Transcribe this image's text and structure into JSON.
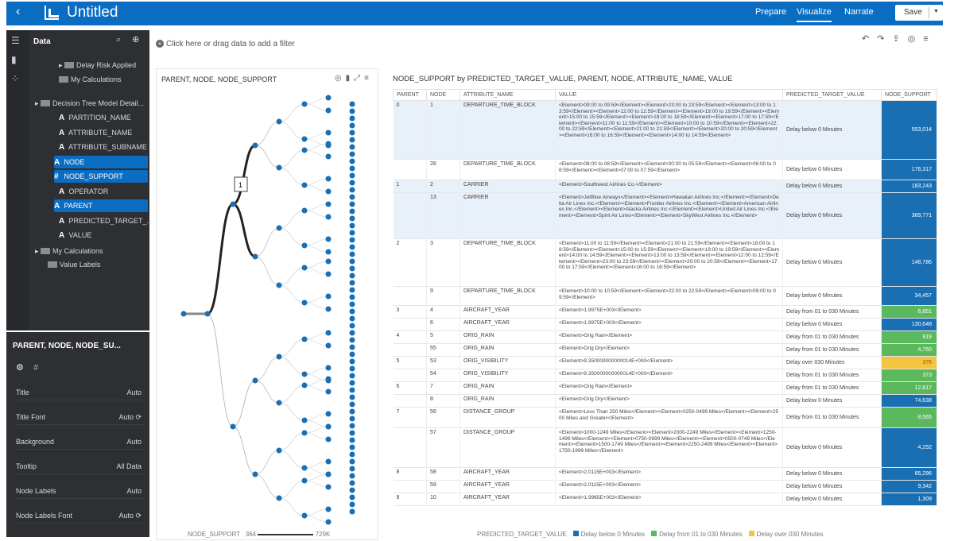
{
  "topbar": {
    "back": "‹",
    "title": "Untitled",
    "nav": [
      "Prepare",
      "Visualize",
      "Narrate"
    ],
    "active_nav": "Visualize",
    "save": "Save",
    "caret": "▼"
  },
  "data_panel": {
    "title": "Data",
    "items": [
      {
        "label": "Delay Risk Applied"
      },
      {
        "label": "My Calculations"
      },
      {
        "label": "Decision Tree Model Detail..."
      },
      {
        "label": "PARTITION_NAME",
        "glyph": "A"
      },
      {
        "label": "ATTRIBUTE_NAME",
        "glyph": "A"
      },
      {
        "label": "ATTRIBUTE_SUBNAME",
        "glyph": "A"
      },
      {
        "label": "NODE",
        "glyph": "A",
        "selected": true
      },
      {
        "label": "NODE_SUPPORT",
        "glyph": "#",
        "selected": true
      },
      {
        "label": "OPERATOR",
        "glyph": "A"
      },
      {
        "label": "PARENT",
        "glyph": "A",
        "selected": true
      },
      {
        "label": "PREDICTED_TARGET_...",
        "glyph": "A"
      },
      {
        "label": "VALUE",
        "glyph": "A"
      },
      {
        "label": "My Calculations"
      },
      {
        "label": "Value Labels"
      }
    ]
  },
  "props_panel": {
    "header": "PARENT, NODE, NODE_SU...",
    "tab2": "#",
    "rows": [
      {
        "label": "Title",
        "value": "Auto"
      },
      {
        "label": "Title Font",
        "value": "Auto ⟳"
      },
      {
        "label": "Background",
        "value": "Auto"
      },
      {
        "label": "Tooltip",
        "value": "All Data"
      },
      {
        "label": "Node Labels",
        "value": "Auto"
      },
      {
        "label": "Node Labels Font",
        "value": "Auto ⟳"
      }
    ]
  },
  "filter_bar": {
    "placeholder": "Click here or drag data to add a filter"
  },
  "tree_panel": {
    "title": "PARENT, NODE, NODE_SUPPORT",
    "tooltip_value": "1",
    "legend": {
      "label": "NODE_SUPPORT",
      "min": "364",
      "max": "729K"
    }
  },
  "table_panel": {
    "title": "NODE_SUPPORT by PREDICTED_TARGET_VALUE, PARENT, NODE, ATTRIBUTE_NAME, VALUE",
    "columns": [
      "PARENT",
      "NODE",
      "ATTRIBUTE_NAME",
      "VALUE",
      "PREDICTED_TARGET_VALUE",
      "NODE_SUPPORT"
    ],
    "rows": [
      {
        "parent": "0",
        "node": "1",
        "attr": "DEPARTURE_TIME_BLOCK",
        "value": "<Element>09:00 to 09:59</Element><Element>23:00 to 23:59</Element><Element>13:00 to 13:59</Element><Element>12:00 to 12:59</Element><Element>19:00 to 19:59</Element><Element>15:00 to 15:59</Element><Element>18:00 to 18:59</Element><Element>17:00 to 17:59</Element><Element>11:00 to 11:59</Element><Element>10:00 to 10:59</Element><Element>22:00 to 22:59</Element><Element>21:00 to 21:59</Element><Element>20:00 to 20:59</Element><Element>16:00 to 16:59</Element><Element>14:00 to 14:59</Element>",
        "pred": "Delay below 0 Minutes",
        "support": "553,014",
        "cls": "blue",
        "hl": true,
        "h": 74
      },
      {
        "parent": "",
        "node": "28",
        "attr": "DEPARTURE_TIME_BLOCK",
        "value": "<Element>08:00 to 08:59</Element><Element>00:00 to 05:59</Element><Element>06:00 to 06:59</Element><Element>07:00 to 07:59</Element>",
        "pred": "Delay below 0 Minutes",
        "support": "176,317",
        "cls": "blue",
        "hl": false,
        "h": 26
      },
      {
        "parent": "1",
        "node": "2",
        "attr": "CARRIER",
        "value": "<Element>Southwest Airlines Co.</Element>",
        "pred": "Delay below 0 Minutes",
        "support": "183,243",
        "cls": "blue",
        "hl": true,
        "h": 16
      },
      {
        "parent": "",
        "node": "13",
        "attr": "CARRIER",
        "value": "<Element>JetBlue Airways</Element><Element>Hawaiian Airlines Inc.</Element><Element>Delta Air Lines Inc.</Element><Element>Frontier Airlines Inc.</Element><Element>American Airlines Inc.</Element><Element>Alaska Airlines Inc.</Element><Element>United Air Lines Inc.</Element><Element>Spirit Air Lines</Element><Element>SkyWest Airlines Inc.</Element>",
        "pred": "Delay below 0 Minutes",
        "support": "369,771",
        "cls": "blue",
        "hl": true,
        "h": 58
      },
      {
        "parent": "2",
        "node": "3",
        "attr": "DEPARTURE_TIME_BLOCK",
        "value": "<Element>11:00 to 11:59</Element><Element>21:00 to 21:59</Element><Element>18:00 to 18:59</Element><Element>15:00 to 15:59</Element><Element>19:00 to 19:59</Element><Element>14:00 to 14:59</Element><Element>13:00 to 13:59</Element><Element>12:00 to 12:59</Element><Element>23:00 to 23:59</Element><Element>20:00 to 20:59</Element><Element>17:00 to 17:59</Element><Element>16:00 to 16:59</Element>",
        "pred": "Delay below 0 Minutes",
        "support": "148,786",
        "cls": "blue",
        "hl": false,
        "h": 60
      },
      {
        "parent": "",
        "node": "9",
        "attr": "DEPARTURE_TIME_BLOCK",
        "value": "<Element>10:00 to 10:59</Element><Element>22:00 to 22:59</Element><Element>09:00 to 09:59</Element>",
        "pred": "Delay below 0 Minutes",
        "support": "34,457",
        "cls": "blue",
        "hl": false,
        "h": 24
      },
      {
        "parent": "3",
        "node": "4",
        "attr": "AIRCRAFT_YEAR",
        "value": "<Element>1.9975E+003</Element>",
        "pred": "Delay from 01 to 030 Minutes",
        "support": "6,851",
        "cls": "green",
        "hl": false,
        "h": 16
      },
      {
        "parent": "",
        "node": "6",
        "attr": "AIRCRAFT_YEAR",
        "value": "<Element>1.9975E+003</Element>",
        "pred": "Delay below 0 Minutes",
        "support": "130,648",
        "cls": "blue",
        "hl": false,
        "h": 16
      },
      {
        "parent": "4",
        "node": "5",
        "attr": "ORIG_RAIN",
        "value": "<Element>Orig Rain</Element>",
        "pred": "Delay from 01 to 030 Minutes",
        "support": "819",
        "cls": "green",
        "hl": false,
        "h": 16
      },
      {
        "parent": "",
        "node": "55",
        "attr": "ORIG_RAIN",
        "value": "<Element>Orig Dry</Element>",
        "pred": "Delay from 01 to 030 Minutes",
        "support": "4,750",
        "cls": "green",
        "hl": false,
        "h": 16
      },
      {
        "parent": "5",
        "node": "53",
        "attr": "ORIG_VISIBILITY",
        "value": "<Element>9.350000000000014E+000</Element>",
        "pred": "Delay over 030 Minutes",
        "support": "376",
        "cls": "yellow",
        "hl": false,
        "h": 16
      },
      {
        "parent": "",
        "node": "54",
        "attr": "ORIG_VISIBILITY",
        "value": "<Element>9.350000000000014E+000</Element>",
        "pred": "Delay from 01 to 030 Minutes",
        "support": "373",
        "cls": "green",
        "hl": false,
        "h": 16
      },
      {
        "parent": "6",
        "node": "7",
        "attr": "ORIG_RAIN",
        "value": "<Element>Orig Rain</Element>",
        "pred": "Delay from 01 to 030 Minutes",
        "support": "12,817",
        "cls": "green",
        "hl": false,
        "h": 16
      },
      {
        "parent": "",
        "node": "8",
        "attr": "ORIG_RAIN",
        "value": "<Element>Orig Dry</Element>",
        "pred": "Delay below 0 Minutes",
        "support": "74,638",
        "cls": "blue",
        "hl": false,
        "h": 16
      },
      {
        "parent": "7",
        "node": "56",
        "attr": "DISTANCE_GROUP",
        "value": "<Element>Less Than 250 Miles</Element><Element>0250-0499 Miles</Element><Element>2500 Miles and Greater</Element>",
        "pred": "Delay from 01 to 030 Minutes",
        "support": "8,565",
        "cls": "green",
        "hl": false,
        "h": 26
      },
      {
        "parent": "",
        "node": "57",
        "attr": "DISTANCE_GROUP",
        "value": "<Element>1000-1249 Miles</Element><Element>2000-2249 Miles</Element><Element>1250-1499 Miles</Element><Element>0750-0999 Miles</Element><Element>0500-0749 Miles</Element><Element>1500-1749 Miles</Element><Element>2250-2499 Miles</Element><Element>1750-1999 Miles</Element>",
        "pred": "Delay below 0 Minutes",
        "support": "4,252",
        "cls": "blue",
        "hl": false,
        "h": 50
      },
      {
        "parent": "8",
        "node": "58",
        "attr": "AIRCRAFT_YEAR",
        "value": "<Element>2.0115E+003</Element>",
        "pred": "Delay below 0 Minutes",
        "support": "65,296",
        "cls": "blue",
        "hl": false,
        "h": 16
      },
      {
        "parent": "",
        "node": "59",
        "attr": "AIRCRAFT_YEAR",
        "value": "<Element>2.0115E+003</Element>",
        "pred": "Delay below 0 Minutes",
        "support": "9,342",
        "cls": "blue",
        "hl": false,
        "h": 16
      },
      {
        "parent": "9",
        "node": "10",
        "attr": "AIRCRAFT_YEAR",
        "value": "<Element>1.9965E+003</Element>",
        "pred": "Delay below 0 Minutes",
        "support": "1,309",
        "cls": "blue",
        "hl": false,
        "h": 16
      }
    ]
  },
  "table_legend": {
    "label": "PREDICTED_TARGET_VALUE",
    "items": [
      {
        "label": "Delay below 0 Minutes",
        "color": "#1a6fb3"
      },
      {
        "label": "Delay from 01 to 030 Minutes",
        "color": "#5cb85c"
      },
      {
        "label": "Delay over 030 Minutes",
        "color": "#f5c542"
      }
    ]
  },
  "colors": {
    "blue": "#1a6fb3",
    "green": "#5cb85c",
    "yellow": "#f5c542",
    "accent": "#0a6dc2"
  }
}
